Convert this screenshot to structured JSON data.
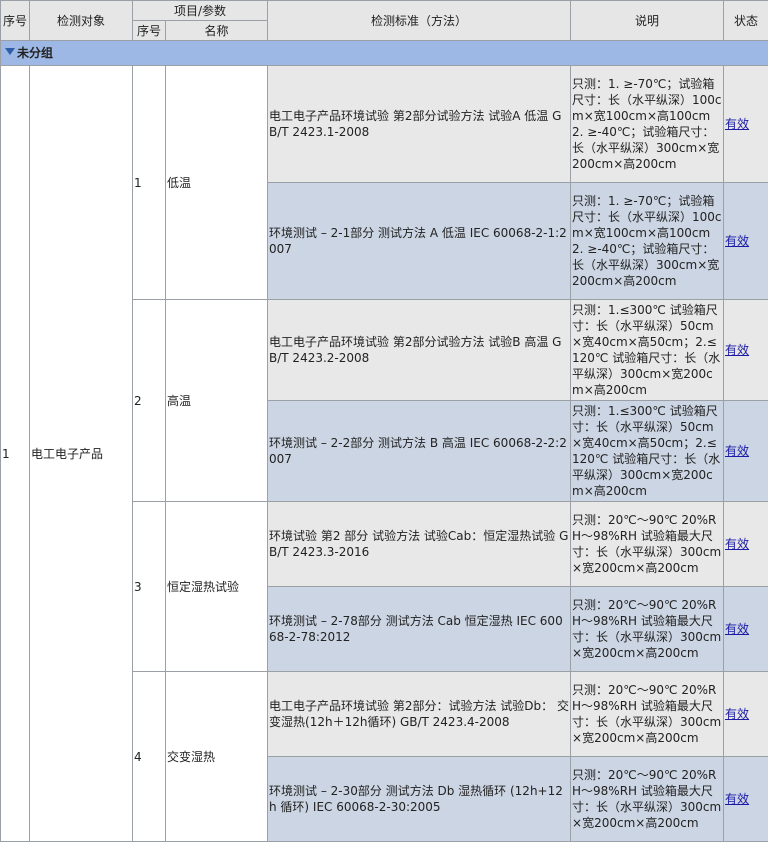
{
  "header": {
    "seq": "序号",
    "object": "检测对象",
    "item_param": "项目/参数",
    "sub_seq": "序号",
    "sub_name": "名称",
    "standard": "检测标准（方法）",
    "desc": "说明",
    "status": "状态"
  },
  "group": {
    "label": "未分组"
  },
  "object": {
    "seq": "1",
    "name": "电工电子产品"
  },
  "items": [
    {
      "seq": "1",
      "name": "低温",
      "rows": [
        {
          "standard": "电工电子产品环境试验 第2部分试验方法 试验A 低温 GB/T 2423.1-2008",
          "desc": "只测：1. ≥-70℃；试验箱尺寸：长（水平纵深）100cm×宽100cm×高100cm 2. ≥-40℃；试验箱尺寸：长（水平纵深）300cm×宽200cm×高200cm",
          "status": "有效"
        },
        {
          "standard": "环境测试 – 2-1部分 测试方法 A 低温 IEC 60068-2-1:2007",
          "desc": "只测：1. ≥-70℃；试验箱尺寸：长（水平纵深）100cm×宽100cm×高100cm 2. ≥-40℃；试验箱尺寸：长（水平纵深）300cm×宽200cm×高200cm",
          "status": "有效"
        }
      ]
    },
    {
      "seq": "2",
      "name": "高温",
      "rows": [
        {
          "standard": "电工电子产品环境试验 第2部分试验方法 试验B 高温 GB/T 2423.2-2008",
          "desc": "只测：1.≤300℃ 试验箱尺寸：长（水平纵深）50cm×宽40cm×高50cm；2.≤120℃ 试验箱尺寸：长（水平纵深）300cm×宽200cm×高200cm",
          "status": "有效"
        },
        {
          "standard": "环境测试 – 2-2部分 测试方法 B 高温 IEC 60068-2-2:2007",
          "desc": "只测：1.≤300℃ 试验箱尺寸：长（水平纵深）50cm×宽40cm×高50cm；2.≤120℃ 试验箱尺寸：长（水平纵深）300cm×宽200cm×高200cm",
          "status": "有效"
        }
      ]
    },
    {
      "seq": "3",
      "name": "恒定湿热试验",
      "rows": [
        {
          "standard": "环境试验 第2 部分 试验方法 试验Cab：恒定湿热试验 GB/T 2423.3-2016",
          "desc": "只测：20℃～90℃ 20%RH～98%RH 试验箱最大尺寸：长（水平纵深）300cm×宽200cm×高200cm",
          "status": "有效"
        },
        {
          "standard": "环境测试 – 2-78部分 测试方法 Cab 恒定湿热 IEC 60068-2-78:2012",
          "desc": "只测：20℃～90℃ 20%RH～98%RH 试验箱最大尺寸：长（水平纵深）300cm×宽200cm×高200cm",
          "status": "有效"
        }
      ]
    },
    {
      "seq": "4",
      "name": "交变湿热",
      "rows": [
        {
          "standard": "电工电子产品环境试验 第2部分：试验方法 试验Db： 交变湿热(12h＋12h循环) GB/T 2423.4-2008",
          "desc": "只测：20℃～90℃ 20%RH～98%RH 试验箱最大尺寸：长（水平纵深）300cm×宽200cm×高200cm",
          "status": "有效"
        },
        {
          "standard": "环境测试 – 2-30部分 测试方法 Db 湿热循环 (12h+12h 循环) IEC 60068-2-30:2005",
          "desc": "只测：20℃～90℃ 20%RH～98%RH 试验箱最大尺寸：长（水平纵深）300cm×宽200cm×高200cm",
          "status": "有效"
        }
      ]
    }
  ]
}
